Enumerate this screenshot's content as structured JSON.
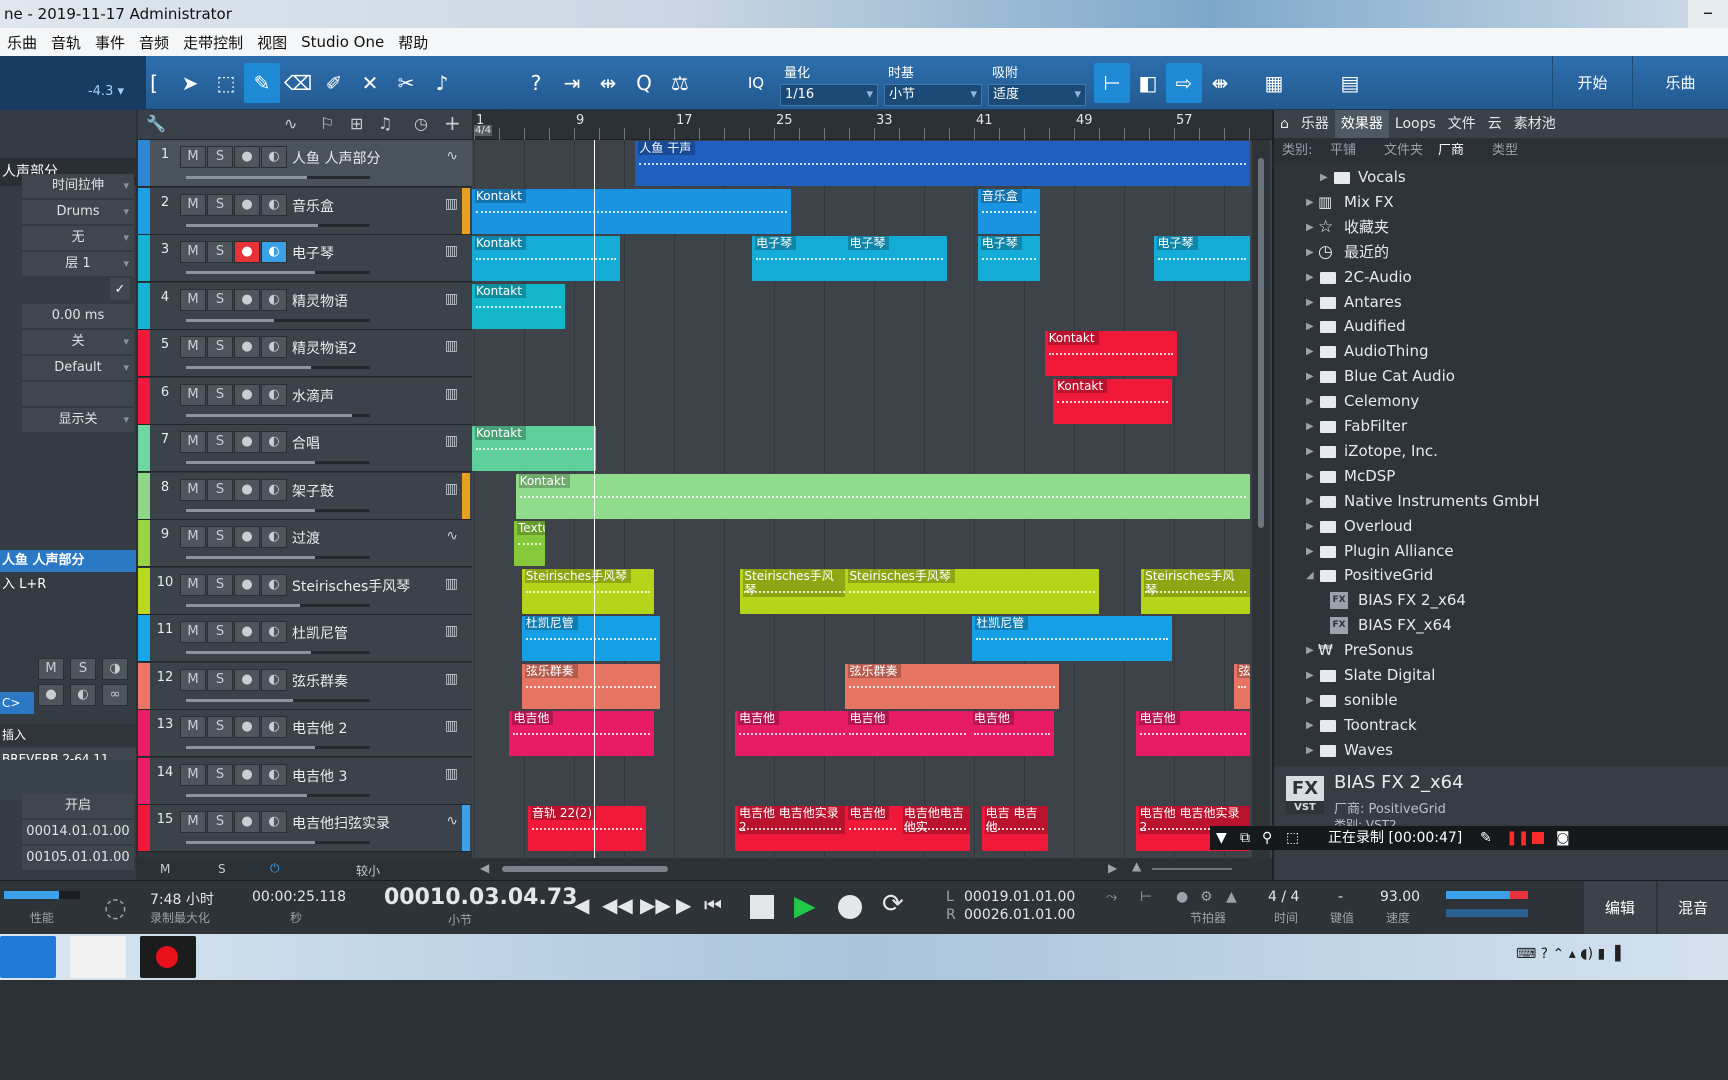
{
  "window": {
    "title": "ne - 2019-11-17 Administrator"
  },
  "menu": [
    "乐曲",
    "音轨",
    "事件",
    "音频",
    "走带控制",
    "视图",
    "Studio One",
    "帮助"
  ],
  "toolbar": {
    "volume": "-4.3 ▾",
    "quantize_label": "量化",
    "quantize_value": "1/16",
    "timebase_label": "时基",
    "timebase_value": "小节",
    "snap_label": "吸附",
    "snap_value": "适度",
    "start_label": "开始",
    "song_label": "乐曲",
    "iq_label": "IQ"
  },
  "inspector": {
    "track_title": "人声部分",
    "rows": [
      "时间拉伸",
      "Drums",
      "无",
      "层 1",
      "",
      "0.00 ms",
      "关",
      "Default",
      "",
      "显示关"
    ],
    "channel_title": "人鱼 人声部分",
    "input": "入 L+R",
    "m_label": "M",
    "s_label": "S",
    "output_label": "C>",
    "inserts_label": "插入",
    "insert_plugin": "BREVERB 2-64 11",
    "start_btn": "开启",
    "time1": "00014.01.01.00",
    "time2": "00105.01.01.00"
  },
  "tracklist_footer": {
    "m": "M",
    "s": "S",
    "size": "较小"
  },
  "tracks": [
    {
      "num": "1",
      "name": "人鱼 人声部分",
      "color": "#2e86d6",
      "type": "audio",
      "fader": 0.66
    },
    {
      "num": "2",
      "name": "音乐盒",
      "color": "#1f9fe8",
      "type": "inst",
      "fader": 0.72
    },
    {
      "num": "3",
      "name": "电子琴",
      "color": "#17b3d6",
      "type": "inst",
      "fader": 0.7
    },
    {
      "num": "4",
      "name": "精灵物语",
      "color": "#17b3d6",
      "type": "inst",
      "fader": 0.48
    },
    {
      "num": "5",
      "name": "精灵物语2",
      "color": "#f0193a",
      "type": "inst",
      "fader": 0.68
    },
    {
      "num": "6",
      "name": "水滴声",
      "color": "#f0193a",
      "type": "inst",
      "fader": 0.9
    },
    {
      "num": "7",
      "name": "合唱",
      "color": "#6fd7a0",
      "type": "inst",
      "fader": 0.7
    },
    {
      "num": "8",
      "name": "架子鼓",
      "color": "#8ed68a",
      "type": "inst",
      "fader": 0.7
    },
    {
      "num": "9",
      "name": "过渡",
      "color": "#9bd246",
      "type": "audio",
      "fader": 0.7
    },
    {
      "num": "10",
      "name": "Steirisches手风琴",
      "color": "#b9d91e",
      "type": "inst",
      "fader": 0.62
    },
    {
      "num": "11",
      "name": "杜凯尼管",
      "color": "#17a6e8",
      "type": "inst",
      "fader": 0.68
    },
    {
      "num": "12",
      "name": "弦乐群奏",
      "color": "#ee7666",
      "type": "inst",
      "fader": 0.58
    },
    {
      "num": "13",
      "name": "电吉他 2",
      "color": "#ea1e66",
      "type": "inst",
      "fader": 0.7
    },
    {
      "num": "14",
      "name": "电吉他 3",
      "color": "#ea1e66",
      "type": "inst",
      "fader": 0.66
    },
    {
      "num": "15",
      "name": "电吉他扫弦实录",
      "color": "#f0193a",
      "type": "audio",
      "fader": 0.7
    }
  ],
  "ruler": [
    "1",
    "9",
    "17",
    "25",
    "33",
    "41",
    "49",
    "57"
  ],
  "ruler_sig": "4/4",
  "clips": [
    {
      "track": 1,
      "start": 0.21,
      "end": 1.0,
      "label": "人鱼 干声",
      "color": "#1f5fbf"
    },
    {
      "track": 2,
      "start": 0.0,
      "end": 0.41,
      "label": "Kontakt",
      "color": "#1a93e0"
    },
    {
      "track": 2,
      "start": 0.65,
      "end": 0.73,
      "label": "音乐盒",
      "color": "#1a93e0"
    },
    {
      "track": 3,
      "start": 0.0,
      "end": 0.19,
      "label": "Kontakt",
      "color": "#14acd6"
    },
    {
      "track": 3,
      "start": 0.36,
      "end": 0.49,
      "label": "电子琴",
      "color": "#14acd6"
    },
    {
      "track": 3,
      "start": 0.48,
      "end": 0.61,
      "label": "电子琴",
      "color": "#14acd6"
    },
    {
      "track": 3,
      "start": 0.65,
      "end": 0.73,
      "label": "电子琴",
      "color": "#14acd6"
    },
    {
      "track": 3,
      "start": 0.876,
      "end": 1.0,
      "label": "电子琴",
      "color": "#14acd6"
    },
    {
      "track": 4,
      "start": 0.0,
      "end": 0.12,
      "label": "Kontakt",
      "color": "#14b6c9"
    },
    {
      "track": 5,
      "start": 0.736,
      "end": 0.906,
      "label": "Kontakt",
      "color": "#f0193a"
    },
    {
      "track": 6,
      "start": 0.747,
      "end": 0.9,
      "label": "Kontakt",
      "color": "#f0193a"
    },
    {
      "track": 7,
      "start": 0.0,
      "end": 0.159,
      "label": "Kontakt",
      "color": "#5ed099"
    },
    {
      "track": 8,
      "start": 0.056,
      "end": 1.0,
      "label": "Kontakt",
      "color": "#8fdc8c"
    },
    {
      "track": 9,
      "start": 0.054,
      "end": 0.094,
      "label": "Textu",
      "color": "#86c83a"
    },
    {
      "track": 10,
      "start": 0.064,
      "end": 0.234,
      "label": "Steirisches手风琴",
      "color": "#b6d51a"
    },
    {
      "track": 10,
      "start": 0.345,
      "end": 0.485,
      "label": "Steirisches手风琴",
      "color": "#b6d51a"
    },
    {
      "track": 10,
      "start": 0.48,
      "end": 0.806,
      "label": "Steirisches手风琴",
      "color": "#b6d51a"
    },
    {
      "track": 10,
      "start": 0.86,
      "end": 1.0,
      "label": "Steirisches手风琴",
      "color": "#b6d51a"
    },
    {
      "track": 11,
      "start": 0.064,
      "end": 0.242,
      "label": "杜凯尼管",
      "color": "#159fe4"
    },
    {
      "track": 11,
      "start": 0.643,
      "end": 0.9,
      "label": "杜凯尼管",
      "color": "#159fe4"
    },
    {
      "track": 12,
      "start": 0.064,
      "end": 0.242,
      "label": "弦乐群奏",
      "color": "#e77563"
    },
    {
      "track": 12,
      "start": 0.48,
      "end": 0.755,
      "label": "弦乐群奏",
      "color": "#e77563"
    },
    {
      "track": 12,
      "start": 0.98,
      "end": 1.0,
      "label": "弦",
      "color": "#e77563"
    },
    {
      "track": 13,
      "start": 0.048,
      "end": 0.234,
      "label": "电吉他",
      "color": "#e81c64"
    },
    {
      "track": 13,
      "start": 0.338,
      "end": 0.485,
      "label": "电吉他",
      "color": "#e81c64"
    },
    {
      "track": 13,
      "start": 0.48,
      "end": 0.64,
      "label": "电吉他",
      "color": "#e81c64"
    },
    {
      "track": 13,
      "start": 0.64,
      "end": 0.748,
      "label": "电吉他",
      "color": "#e81c64"
    },
    {
      "track": 13,
      "start": 0.853,
      "end": 1.0,
      "label": "电吉他",
      "color": "#e81c64"
    },
    {
      "track": 15,
      "start": 0.072,
      "end": 0.224,
      "label": "音轨 22(2)",
      "color": "#f0193a"
    },
    {
      "track": 15,
      "start": 0.338,
      "end": 0.48,
      "label": "电吉他 电吉他实录 2",
      "color": "#f0193a"
    },
    {
      "track": 15,
      "start": 0.48,
      "end": 0.55,
      "label": "电吉他",
      "color": "#f0193a"
    },
    {
      "track": 15,
      "start": 0.55,
      "end": 0.64,
      "label": "电吉他电吉他实",
      "color": "#f0193a"
    },
    {
      "track": 15,
      "start": 0.655,
      "end": 0.74,
      "label": "电吉 电吉他",
      "color": "#f0193a"
    },
    {
      "track": 15,
      "start": 0.853,
      "end": 1.0,
      "label": "电吉他 电吉他实录 2",
      "color": "#f0193a"
    }
  ],
  "browser": {
    "tabs": [
      "乐器",
      "效果器",
      "Loops",
      "文件",
      "云",
      "素材池"
    ],
    "active_tab": "效果器",
    "filter_label": "类别:",
    "filters": [
      "平铺",
      "文件夹",
      "厂商",
      "类型"
    ],
    "items": [
      {
        "label": "Vocals",
        "indent": 2,
        "icon": "folder"
      },
      {
        "label": "Mix FX",
        "indent": 1,
        "icon": "mixfx"
      },
      {
        "label": "收藏夹",
        "indent": 1,
        "icon": "star"
      },
      {
        "label": "最近的",
        "indent": 1,
        "icon": "clock"
      },
      {
        "label": "2C-Audio",
        "indent": 1,
        "icon": "folder"
      },
      {
        "label": "Antares",
        "indent": 1,
        "icon": "folder"
      },
      {
        "label": "Audified",
        "indent": 1,
        "icon": "folder"
      },
      {
        "label": "AudioThing",
        "indent": 1,
        "icon": "folder"
      },
      {
        "label": "Blue Cat Audio",
        "indent": 1,
        "icon": "folder"
      },
      {
        "label": "Celemony",
        "indent": 1,
        "icon": "folder"
      },
      {
        "label": "FabFilter",
        "indent": 1,
        "icon": "folder"
      },
      {
        "label": "iZotope, Inc.",
        "indent": 1,
        "icon": "folder"
      },
      {
        "label": "McDSP",
        "indent": 1,
        "icon": "folder"
      },
      {
        "label": "Native Instruments GmbH",
        "indent": 1,
        "icon": "folder"
      },
      {
        "label": "Overloud",
        "indent": 1,
        "icon": "folder"
      },
      {
        "label": "Plugin Alliance",
        "indent": 1,
        "icon": "folder"
      },
      {
        "label": "PositiveGrid",
        "indent": 1,
        "icon": "folder-open"
      },
      {
        "label": "BIAS FX 2_x64",
        "indent": 2,
        "icon": "fx"
      },
      {
        "label": "BIAS FX_x64",
        "indent": 2,
        "icon": "fx"
      },
      {
        "label": "PreSonus",
        "indent": 1,
        "icon": "presonus"
      },
      {
        "label": "Slate Digital",
        "indent": 1,
        "icon": "folder"
      },
      {
        "label": "sonible",
        "indent": 1,
        "icon": "folder"
      },
      {
        "label": "Toontrack",
        "indent": 1,
        "icon": "folder"
      },
      {
        "label": "Waves",
        "indent": 1,
        "icon": "folder"
      }
    ],
    "info_title": "BIAS FX 2_x64",
    "info_vendor": "厂商: PositiveGrid",
    "info_cat": "类别: VST2",
    "info_fx": "FX",
    "info_vst": "VST"
  },
  "recording": {
    "status": "正在录制 [00:00:47]"
  },
  "transport": {
    "perf_label": "性能",
    "rec_max": "7:48 小时",
    "rec_max_label": "录制最大化",
    "seconds": "00:00:25.118",
    "seconds_label": "秒",
    "position": "00010.03.04.73",
    "position_label": "小节",
    "loop_l": "00019.01.01.00",
    "loop_r": "00026.01.01.00",
    "l_label": "L",
    "r_label": "R",
    "metronome_label": "节拍器",
    "sig": "4 / 4",
    "sig_label": "时间",
    "key": "-",
    "key_label": "键值",
    "tempo": "93.00",
    "tempo_label": "速度",
    "edit_label": "编辑",
    "mix_label": "混音"
  }
}
